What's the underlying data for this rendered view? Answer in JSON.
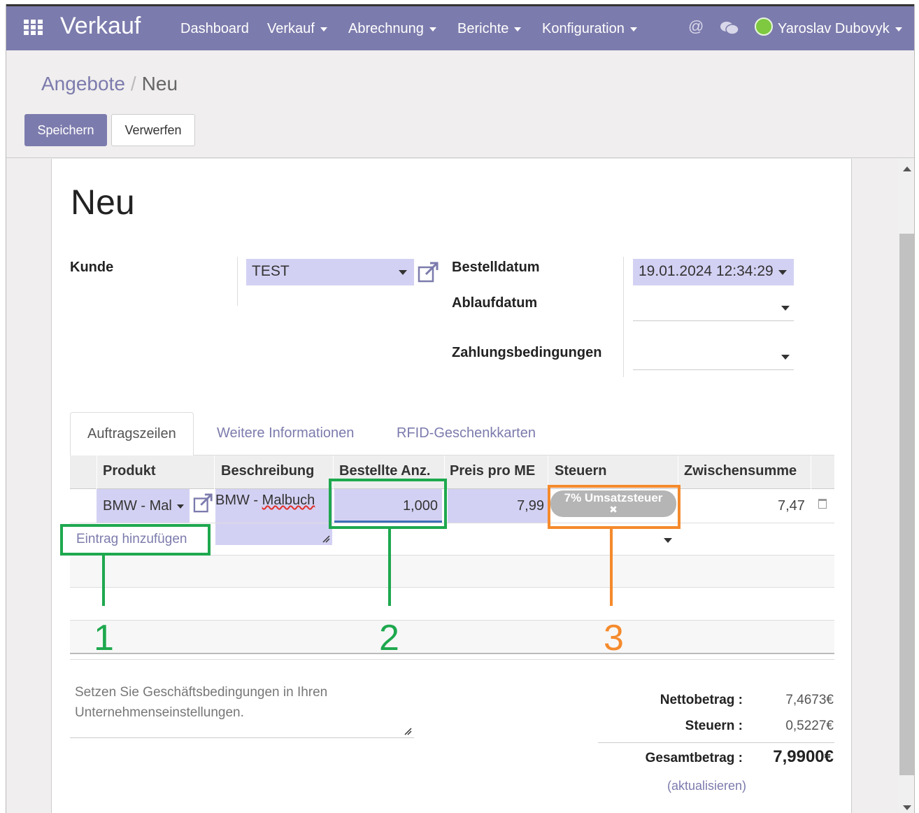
{
  "navbar": {
    "app_name": "Verkauf",
    "menu": [
      "Dashboard",
      "Verkauf",
      "Abrechnung",
      "Berichte",
      "Konfiguration"
    ],
    "user_name": "Yaroslav Dubovyk",
    "mention_icon": "@",
    "chat_icon": "chat-bubbles-icon"
  },
  "breadcrumb": {
    "parent": "Angebote",
    "separator": "/",
    "current": "Neu"
  },
  "buttons": {
    "save": "Speichern",
    "discard": "Verwerfen"
  },
  "form": {
    "title": "Neu",
    "customer_label": "Kunde",
    "customer_value": "TEST",
    "order_date_label": "Bestelldatum",
    "order_date_value": "19.01.2024 12:34:29",
    "expiry_label": "Ablaufdatum",
    "payment_terms_label": "Zahlungsbedingungen"
  },
  "tabs": [
    "Auftragszeilen",
    "Weitere Informationen",
    "RFID-Geschenkkarten"
  ],
  "table": {
    "headers": [
      "Produkt",
      "Beschreibung",
      "Bestellte Anz.",
      "Preis pro ME",
      "Steuern",
      "Zwischensumme"
    ],
    "row": {
      "product": "BMW - Mal",
      "description_prefix": "BMW - ",
      "description_word": "Malbuch",
      "quantity": "1,000",
      "price": "7,99",
      "tax_tag": "7% Umsatzsteuer",
      "tax_remove": "✖",
      "subtotal": "7,47"
    },
    "add_line": "Eintrag hinzufügen"
  },
  "annotations": [
    "1",
    "2",
    "3"
  ],
  "annotation_colors": {
    "green": "#1ea84e",
    "orange": "#f58a2c"
  },
  "terms_placeholder": "Setzen Sie Geschäftsbedingungen in Ihren Unternehmenseinstellungen.",
  "totals": {
    "net_label": "Nettobetrag :",
    "net_value": "7,4673€",
    "tax_label": "Steuern :",
    "tax_value": "0,5227€",
    "total_label": "Gesamtbetrag :",
    "total_value": "7,9900€",
    "update_link": "(aktualisieren)"
  },
  "colors": {
    "brand": "#7c7bad",
    "field_bg": "#d3d1f3"
  }
}
